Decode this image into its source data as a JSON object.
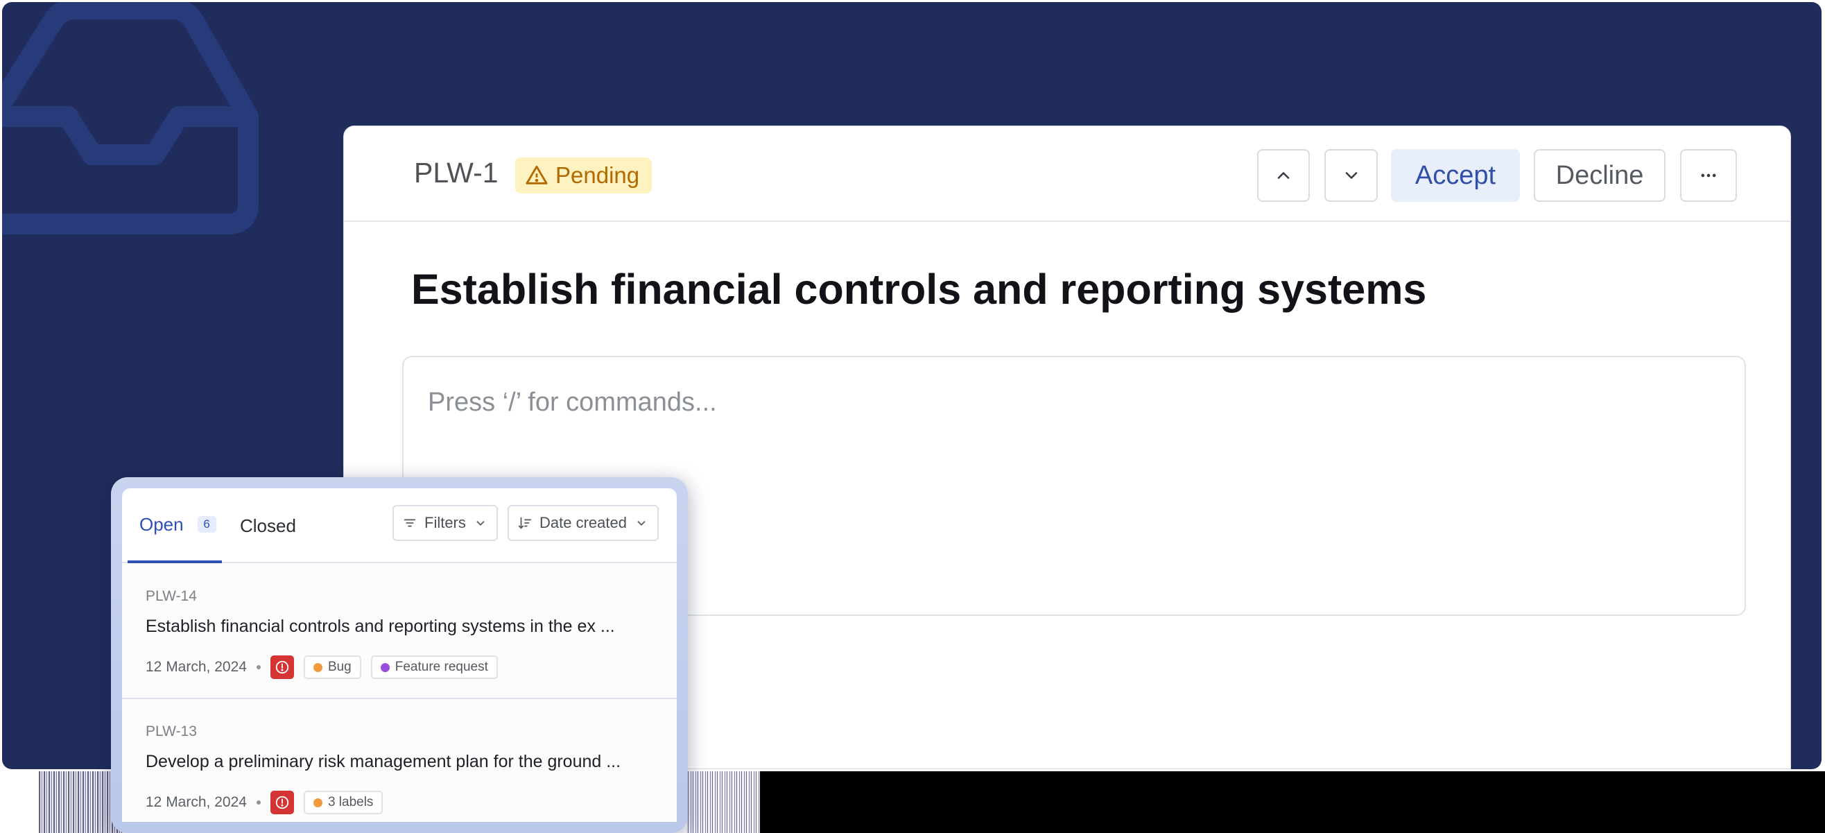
{
  "colors": {
    "background": "#202d5c",
    "accent": "#2f51b5",
    "pending_bg": "#fdf2c0",
    "pending_text": "#b26a00",
    "priority": "#d43434",
    "bug": "#f09a3c",
    "feature_request": "#9b4de0"
  },
  "issue": {
    "id": "PLW-1",
    "status": "Pending",
    "status_icon": "warning-icon",
    "title": "Establish financial controls and reporting systems",
    "editor_placeholder": "Press ‘/’ for commands...",
    "actions": {
      "prev_icon": "chevron-up-icon",
      "next_icon": "chevron-down-icon",
      "accept": "Accept",
      "decline": "Decline",
      "more_icon": "more-horizontal-icon"
    }
  },
  "list": {
    "tabs": [
      {
        "label": "Open",
        "count": "6"
      },
      {
        "label": "Closed"
      }
    ],
    "filters_label": "Filters",
    "sort_label": "Date created",
    "items": [
      {
        "id": "PLW-14",
        "title": "Establish financial controls and reporting systems in the ex ...",
        "date": "12 March, 2024",
        "labels": [
          {
            "text": "Bug",
            "color": "#f09a3c"
          },
          {
            "text": "Feature request",
            "color": "#9b4de0"
          }
        ]
      },
      {
        "id": "PLW-13",
        "title": "Develop a preliminary risk management plan for the ground ...",
        "date": "12 March, 2024",
        "labels": [
          {
            "text": "3 labels",
            "color": "#f09a3c"
          }
        ]
      }
    ]
  }
}
